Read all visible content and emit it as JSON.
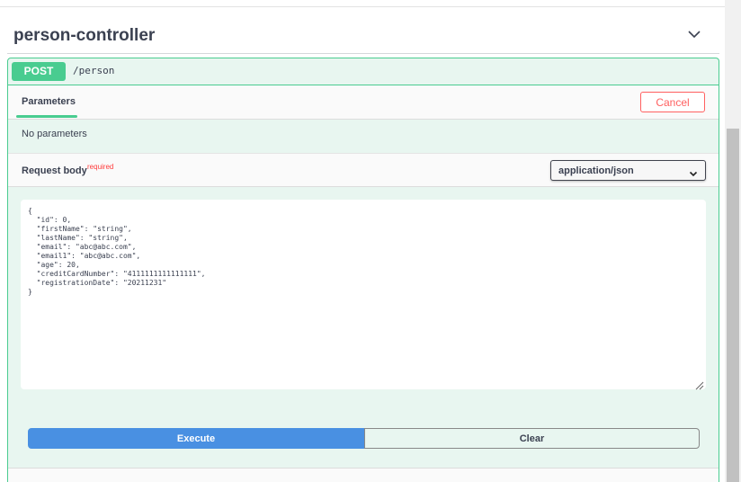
{
  "tag": {
    "title": "person-controller",
    "toggle_icon": "chevron-down-icon"
  },
  "operation": {
    "method": "POST",
    "path": "/person"
  },
  "parameters": {
    "tab_label": "Parameters",
    "cancel_label": "Cancel",
    "empty_text": "No parameters"
  },
  "request_body": {
    "label": "Request body",
    "required_label": "required",
    "content_type": "application/json",
    "lines": [
      "{",
      "  \"id\": 0,",
      "  \"firstName\": \"string\",",
      "  \"lastName\": \"string\",",
      "  \"email\": \"abc@abc.com\",",
      "  \"email1\": \"abc@abc.com\",",
      "  \"age\": 20,",
      "  \"creditCardNumber\": \"4111111111111111\",",
      "  \"registrationDate\": \"20211231\"",
      "}"
    ]
  },
  "actions": {
    "execute_label": "Execute",
    "clear_label": "Clear"
  },
  "colors": {
    "post_green": "#49cc90",
    "cancel_red": "#ff6060",
    "execute_blue": "#4990e2"
  }
}
